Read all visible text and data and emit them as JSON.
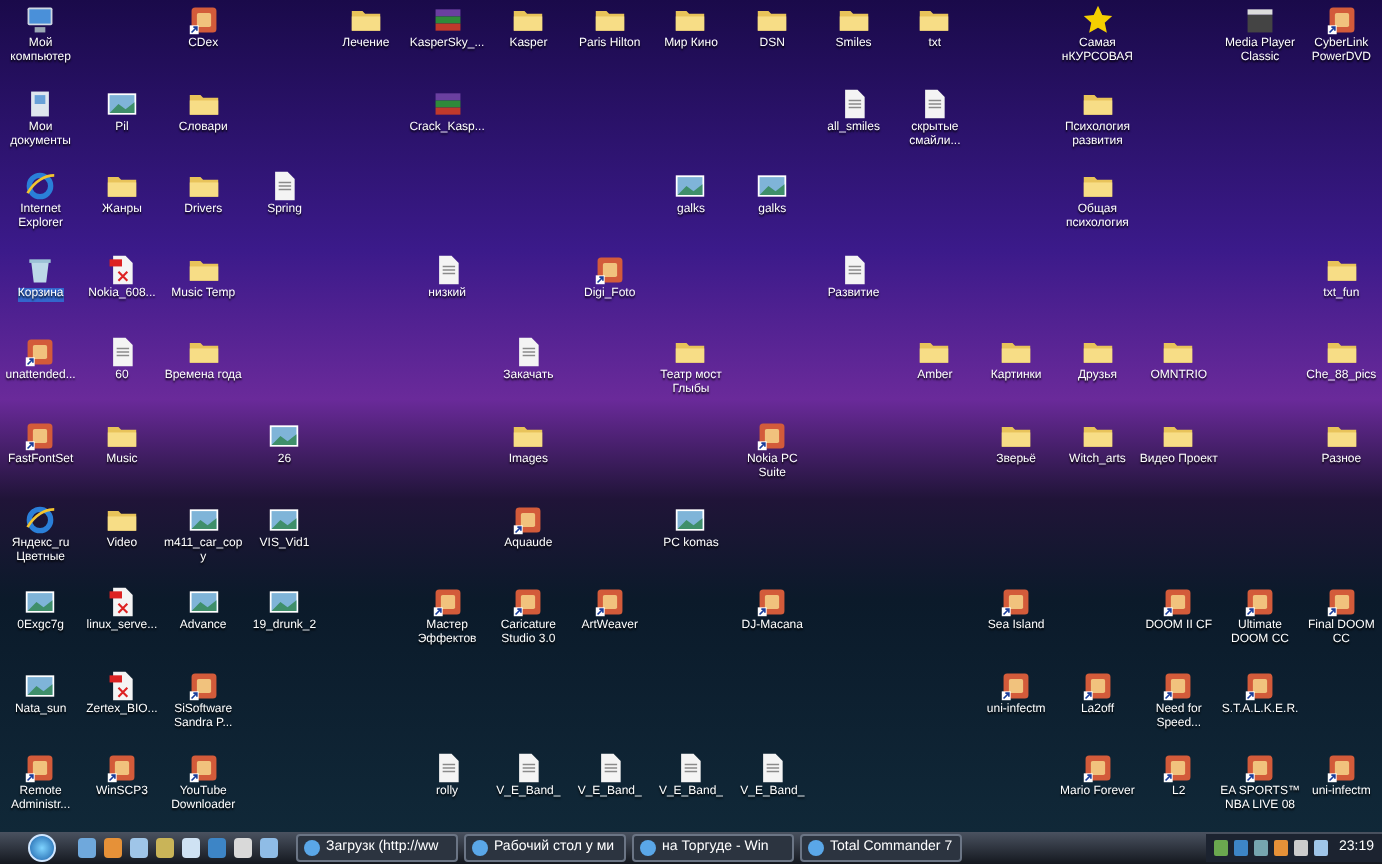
{
  "desktop": {
    "rows": [
      [
        {
          "kind": "computer",
          "label": "Мой компьютер",
          "selected": false
        },
        null,
        {
          "kind": "app",
          "label": "CDex",
          "selected": false
        },
        null,
        {
          "kind": "folder",
          "label": "Лечение",
          "selected": false
        },
        {
          "kind": "archive",
          "label": "KasperSky_...",
          "selected": false
        },
        {
          "kind": "folder",
          "label": "Kasper",
          "selected": false
        },
        {
          "kind": "folder",
          "label": "Paris Hilton",
          "selected": false
        },
        {
          "kind": "folder",
          "label": "Мир Кино",
          "selected": false
        },
        {
          "kind": "folder",
          "label": "DSN",
          "selected": false
        },
        {
          "kind": "folder",
          "label": "Smiles",
          "selected": false
        },
        {
          "kind": "folder",
          "label": "txt",
          "selected": false
        },
        null,
        {
          "kind": "star",
          "label": "Самая нКУРСОВАЯ",
          "selected": false
        },
        null,
        {
          "kind": "media",
          "label": "Media Player Classic",
          "selected": false
        },
        {
          "kind": "app",
          "label": "CyberLink PowerDVD",
          "selected": false
        }
      ],
      [
        {
          "kind": "documents",
          "label": "Мои документы",
          "selected": false
        },
        {
          "kind": "image",
          "label": "Pil",
          "selected": false
        },
        {
          "kind": "folder",
          "label": "Словари",
          "selected": false
        },
        null,
        null,
        {
          "kind": "archive",
          "label": "Crack_Kasp...",
          "selected": false
        },
        null,
        null,
        null,
        null,
        {
          "kind": "document",
          "label": "all_smiles",
          "selected": false
        },
        {
          "kind": "document",
          "label": "скрытые смайли...",
          "selected": false
        },
        null,
        {
          "kind": "folder",
          "label": "Психология развития",
          "selected": false
        },
        null,
        null,
        null
      ],
      [
        {
          "kind": "browser",
          "label": "Internet Explorer",
          "selected": false
        },
        {
          "kind": "folder",
          "label": "Жанры",
          "selected": false
        },
        {
          "kind": "folder",
          "label": "Drivers",
          "selected": false
        },
        {
          "kind": "document",
          "label": "Spring",
          "selected": false
        },
        null,
        null,
        null,
        null,
        {
          "kind": "image",
          "label": "galks",
          "selected": false
        },
        {
          "kind": "image",
          "label": "galks",
          "selected": false
        },
        null,
        null,
        null,
        {
          "kind": "folder",
          "label": "Общая психология",
          "selected": false
        },
        null,
        null,
        null
      ],
      [
        {
          "kind": "recycle",
          "label": "Корзина",
          "selected": true
        },
        {
          "kind": "pdf",
          "label": "Nokia_608...",
          "selected": false
        },
        {
          "kind": "folder",
          "label": "Music Temp",
          "selected": false
        },
        null,
        null,
        {
          "kind": "document",
          "label": "низкий",
          "selected": false
        },
        null,
        {
          "kind": "app",
          "label": "Digi_Foto",
          "selected": false
        },
        null,
        null,
        {
          "kind": "document",
          "label": "Развитие",
          "selected": false
        },
        null,
        null,
        null,
        null,
        null,
        {
          "kind": "folder",
          "label": "txt_fun",
          "selected": false
        }
      ],
      [
        {
          "kind": "app",
          "label": "unattended...",
          "selected": false
        },
        {
          "kind": "document",
          "label": "60",
          "selected": false
        },
        {
          "kind": "folder",
          "label": "Времена года",
          "selected": false
        },
        null,
        null,
        null,
        {
          "kind": "document",
          "label": "Закачать",
          "selected": false
        },
        null,
        {
          "kind": "folder",
          "label": "Театр мост Глыбы",
          "selected": false
        },
        null,
        null,
        {
          "kind": "folder",
          "label": "Amber",
          "selected": false
        },
        {
          "kind": "folder",
          "label": "Картинки",
          "selected": false
        },
        {
          "kind": "folder",
          "label": "Друзья",
          "selected": false
        },
        {
          "kind": "folder",
          "label": "OMNTRIO",
          "selected": false
        },
        null,
        {
          "kind": "folder",
          "label": "Che_88_pics",
          "selected": false
        }
      ],
      [
        {
          "kind": "app",
          "label": "FastFontSet",
          "selected": false
        },
        {
          "kind": "folder",
          "label": "Music",
          "selected": false
        },
        null,
        {
          "kind": "image",
          "label": "26",
          "selected": false
        },
        null,
        null,
        {
          "kind": "folder",
          "label": "Images",
          "selected": false
        },
        null,
        null,
        {
          "kind": "app",
          "label": "Nokia PC Suite",
          "selected": false
        },
        null,
        null,
        {
          "kind": "folder",
          "label": "Зверьё",
          "selected": false
        },
        {
          "kind": "folder",
          "label": "Witch_arts",
          "selected": false
        },
        {
          "kind": "folder",
          "label": "Видео Проект",
          "selected": false
        },
        null,
        {
          "kind": "folder",
          "label": "Разное",
          "selected": false
        }
      ],
      [
        {
          "kind": "browser",
          "label": "Яндекс_ru Цветные",
          "selected": false
        },
        {
          "kind": "folder",
          "label": "Video",
          "selected": false
        },
        {
          "kind": "image",
          "label": "m411_car_copy",
          "selected": false
        },
        {
          "kind": "image",
          "label": "VIS_Vid1",
          "selected": false
        },
        null,
        null,
        {
          "kind": "app",
          "label": "Aquaude",
          "selected": false
        },
        null,
        {
          "kind": "image",
          "label": "PC komas",
          "selected": false
        },
        null,
        null,
        null,
        null,
        null,
        null,
        null,
        null
      ],
      [
        {
          "kind": "image",
          "label": "0Exgc7g",
          "selected": false
        },
        {
          "kind": "pdf",
          "label": "linux_serve...",
          "selected": false
        },
        {
          "kind": "image",
          "label": "Advance",
          "selected": false
        },
        {
          "kind": "image",
          "label": "19_drunk_2",
          "selected": false
        },
        null,
        {
          "kind": "app",
          "label": "Мастер Эффектов",
          "selected": false
        },
        {
          "kind": "app",
          "label": "Caricature Studio 3.0",
          "selected": false
        },
        {
          "kind": "app",
          "label": "ArtWeaver",
          "selected": false
        },
        null,
        {
          "kind": "app",
          "label": "DJ-Macana",
          "selected": false
        },
        null,
        null,
        {
          "kind": "app",
          "label": "Sea Island",
          "selected": false
        },
        null,
        {
          "kind": "app",
          "label": "DOOM II CF",
          "selected": false
        },
        {
          "kind": "app",
          "label": "Ultimate DOOM CC",
          "selected": false
        },
        {
          "kind": "app",
          "label": "Final DOOM CC",
          "selected": false
        }
      ],
      [
        {
          "kind": "image",
          "label": "Nata_sun",
          "selected": false
        },
        {
          "kind": "pdf",
          "label": "Zertex_BIO...",
          "selected": false
        },
        {
          "kind": "app",
          "label": "SiSoftware Sandra P...",
          "selected": false
        },
        null,
        null,
        null,
        null,
        null,
        null,
        null,
        null,
        null,
        {
          "kind": "app",
          "label": "uni-infectm",
          "selected": false
        },
        {
          "kind": "app",
          "label": "La2off",
          "selected": false
        },
        {
          "kind": "app",
          "label": "Need for Speed...",
          "selected": false
        },
        {
          "kind": "app",
          "label": "S.T.A.L.K.E.R.",
          "selected": false
        },
        null
      ],
      [
        {
          "kind": "app",
          "label": "Remote Administr...",
          "selected": false
        },
        {
          "kind": "app",
          "label": "WinSCP3",
          "selected": false
        },
        {
          "kind": "app",
          "label": "YouTube Downloader",
          "selected": false
        },
        null,
        null,
        {
          "kind": "document",
          "label": "rolly",
          "selected": false
        },
        {
          "kind": "document",
          "label": "V_E_Band_",
          "selected": false
        },
        {
          "kind": "document",
          "label": "V_E_Band_",
          "selected": false
        },
        {
          "kind": "document",
          "label": "V_E_Band_",
          "selected": false
        },
        {
          "kind": "document",
          "label": "V_E_Band_",
          "selected": false
        },
        null,
        null,
        null,
        {
          "kind": "app",
          "label": "Mario Forever",
          "selected": false
        },
        {
          "kind": "app",
          "label": "L2",
          "selected": false
        },
        {
          "kind": "app",
          "label": "EA SPORTS™ NBA LIVE 08",
          "selected": false
        },
        {
          "kind": "app",
          "label": "uni-infectm",
          "selected": false
        }
      ]
    ]
  },
  "taskbar": {
    "tasks": [
      {
        "label": "Загрузк (http://ww"
      },
      {
        "label": "Рабочий стол у ми"
      },
      {
        "label": "на Торгуде - Win"
      },
      {
        "label": "Total Commander 7"
      }
    ],
    "clock": "23:19"
  }
}
